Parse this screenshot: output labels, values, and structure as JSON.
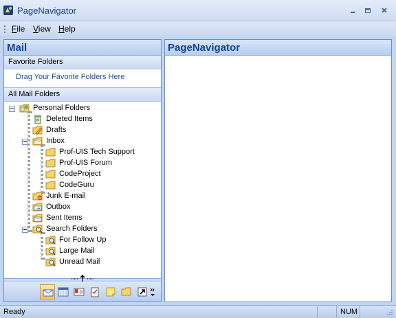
{
  "window": {
    "title": "PageNavigator",
    "controls": [
      "minimize",
      "maximize",
      "close"
    ]
  },
  "menu": {
    "items": [
      {
        "label": "File",
        "mnemonic": "F",
        "rest": "ile"
      },
      {
        "label": "View",
        "mnemonic": "V",
        "rest": "iew"
      },
      {
        "label": "Help",
        "mnemonic": "H",
        "rest": "elp"
      }
    ]
  },
  "left_pane": {
    "header": "Mail",
    "favorites_header": "Favorite Folders",
    "favorites_placeholder": "Drag Your Favorite Folders Here",
    "all_folders_header": "All Mail Folders",
    "tree": [
      {
        "label": "Personal Folders",
        "icon": "personal-folders-icon",
        "level": 0,
        "expanded": true
      },
      {
        "label": "Deleted Items",
        "icon": "trash-icon",
        "level": 1
      },
      {
        "label": "Drafts",
        "icon": "drafts-icon",
        "level": 1
      },
      {
        "label": "Inbox",
        "icon": "inbox-icon",
        "level": 1,
        "expanded": true
      },
      {
        "label": "Prof-UIS Tech Support",
        "icon": "folder-icon",
        "level": 2
      },
      {
        "label": "Prof-UIS Forum",
        "icon": "folder-icon",
        "level": 2
      },
      {
        "label": "CodeProject",
        "icon": "folder-icon",
        "level": 2
      },
      {
        "label": "CodeGuru",
        "icon": "folder-icon",
        "level": 2
      },
      {
        "label": "Junk E-mail",
        "icon": "junk-mail-icon",
        "level": 1
      },
      {
        "label": "Outbox",
        "icon": "outbox-icon",
        "level": 1
      },
      {
        "label": "Sent Items",
        "icon": "sent-items-icon",
        "level": 1
      },
      {
        "label": "Search Folders",
        "icon": "search-folder-icon",
        "level": 1,
        "expanded": true
      },
      {
        "label": "For Follow Up",
        "icon": "search-folder-icon",
        "level": 2
      },
      {
        "label": "Large Mail",
        "icon": "search-folder-icon",
        "level": 2
      },
      {
        "label": "Unread Mail",
        "icon": "search-folder-icon",
        "level": 2
      }
    ],
    "nav_buttons": [
      {
        "name": "mail-icon",
        "active": true
      },
      {
        "name": "calendar-icon",
        "active": false
      },
      {
        "name": "contacts-icon",
        "active": false
      },
      {
        "name": "tasks-icon",
        "active": false
      },
      {
        "name": "notes-icon",
        "active": false
      },
      {
        "name": "folder-list-icon",
        "active": false
      },
      {
        "name": "shortcuts-icon",
        "active": false
      },
      {
        "name": "configure-buttons-icon",
        "active": false
      }
    ]
  },
  "right_pane": {
    "header": "PageNavigator"
  },
  "status": {
    "text": "Ready",
    "num": "NUM"
  },
  "colors": {
    "header_text": "#15428b",
    "frame_bg": "#c4d5f2",
    "link_blue": "#1c4f9c"
  }
}
